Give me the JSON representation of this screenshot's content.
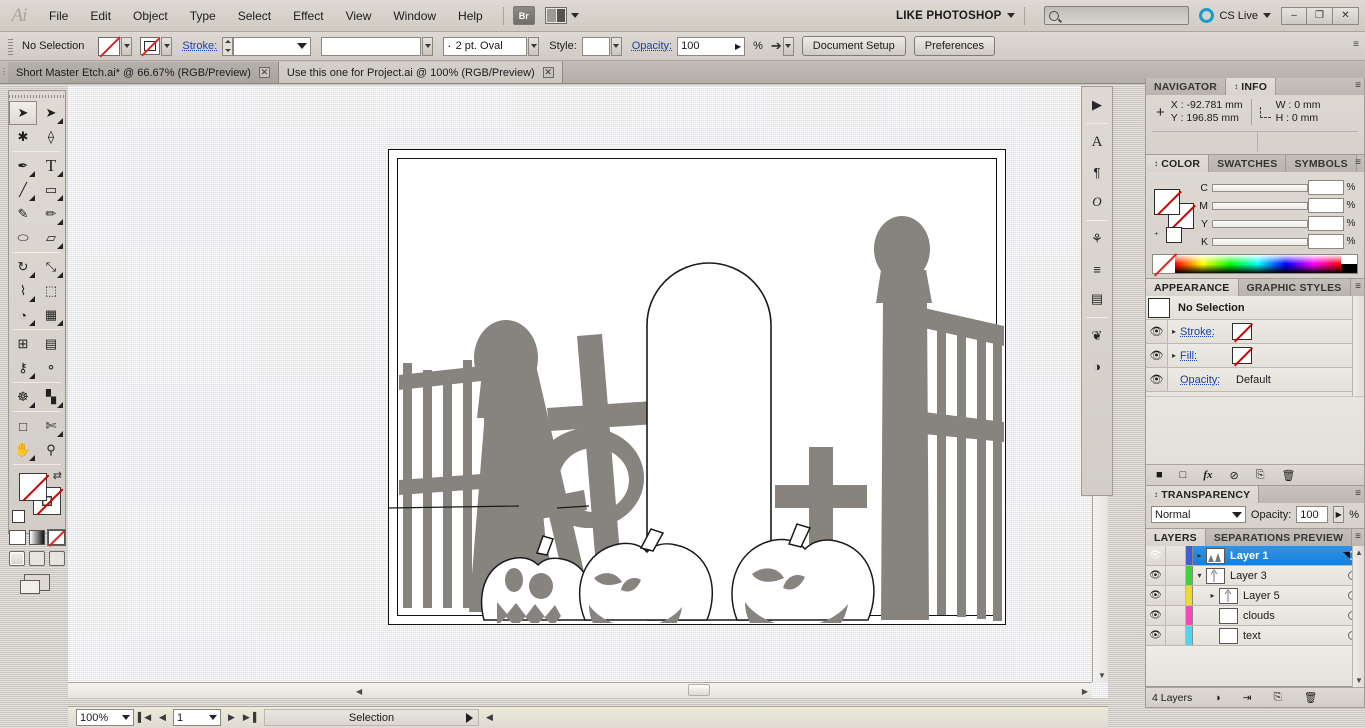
{
  "app": {
    "logo": "Ai",
    "workspace": "LIKE PHOTOSHOP",
    "cs_live": "CS Live",
    "search_placeholder": ""
  },
  "menus": [
    "File",
    "Edit",
    "Object",
    "Type",
    "Select",
    "Effect",
    "View",
    "Window",
    "Help"
  ],
  "menu_icons": {
    "bridge": "Br",
    "arrange": "arrange-documents-icon"
  },
  "window_buttons": {
    "minimize": "–",
    "restore": "❐",
    "close": "✕"
  },
  "control_bar": {
    "selection_status": "No Selection",
    "stroke_label": "Stroke:",
    "stroke_weight": "",
    "brush_definition": "",
    "stroke_profile": "2 pt. Oval",
    "style_label": "Style:",
    "opacity_label": "Opacity:",
    "opacity_value": "100",
    "percent": "%",
    "document_setup": "Document Setup",
    "preferences": "Preferences"
  },
  "tabs": [
    {
      "title": "Short Master Etch.ai* @ 66.67% (RGB/Preview)",
      "active": false,
      "close": "✕"
    },
    {
      "title": "Use this one for Project.ai @ 100% (RGB/Preview)",
      "active": true,
      "close": "✕"
    }
  ],
  "toolbar": {
    "tools": [
      {
        "name": "selection-tool",
        "glyph": "➤",
        "selected": true,
        "flyout": false
      },
      {
        "name": "direct-selection-tool",
        "glyph": "➤",
        "selected": false,
        "flyout": true
      },
      {
        "name": "magic-wand-tool",
        "glyph": "✳",
        "selected": false,
        "flyout": false
      },
      {
        "name": "lasso-tool",
        "glyph": "❀",
        "selected": false,
        "flyout": false
      },
      {
        "name": "pen-tool",
        "glyph": "✒",
        "selected": false,
        "flyout": true
      },
      {
        "name": "type-tool",
        "glyph": "T",
        "selected": false,
        "flyout": true
      },
      {
        "name": "line-segment-tool",
        "glyph": "╲",
        "selected": false,
        "flyout": true
      },
      {
        "name": "rectangle-tool",
        "glyph": "▭",
        "selected": false,
        "flyout": true
      },
      {
        "name": "paintbrush-tool",
        "glyph": "✎",
        "selected": false,
        "flyout": false
      },
      {
        "name": "pencil-tool",
        "glyph": "✐",
        "selected": false,
        "flyout": true
      },
      {
        "name": "blob-brush-tool",
        "glyph": "⬭",
        "selected": false,
        "flyout": false
      },
      {
        "name": "eraser-tool",
        "glyph": "▱",
        "selected": false,
        "flyout": true
      },
      {
        "name": "rotate-tool",
        "glyph": "↻",
        "selected": false,
        "flyout": true
      },
      {
        "name": "scale-tool",
        "glyph": "⤡",
        "selected": false,
        "flyout": true
      },
      {
        "name": "width-tool",
        "glyph": "⌇",
        "selected": false,
        "flyout": true
      },
      {
        "name": "free-transform-tool",
        "glyph": "⬚",
        "selected": false,
        "flyout": false
      },
      {
        "name": "shape-builder-tool",
        "glyph": "◔",
        "selected": false,
        "flyout": true
      },
      {
        "name": "perspective-grid-tool",
        "glyph": "▦",
        "selected": false,
        "flyout": true
      },
      {
        "name": "mesh-tool",
        "glyph": "⊞",
        "selected": false,
        "flyout": false
      },
      {
        "name": "gradient-tool",
        "glyph": "▤",
        "selected": false,
        "flyout": false
      },
      {
        "name": "eyedropper-tool",
        "glyph": "⚗",
        "selected": false,
        "flyout": true
      },
      {
        "name": "blend-tool",
        "glyph": "⚬",
        "selected": false,
        "flyout": false
      },
      {
        "name": "symbol-sprayer-tool",
        "glyph": "☸",
        "selected": false,
        "flyout": true
      },
      {
        "name": "column-graph-tool",
        "glyph": "█",
        "selected": false,
        "flyout": true
      },
      {
        "name": "artboard-tool",
        "glyph": "□",
        "selected": false,
        "flyout": false
      },
      {
        "name": "slice-tool",
        "glyph": "✄",
        "selected": false,
        "flyout": true
      },
      {
        "name": "hand-tool",
        "glyph": "✋",
        "selected": false,
        "flyout": true
      },
      {
        "name": "zoom-tool",
        "glyph": "⚲",
        "selected": false,
        "flyout": false
      }
    ],
    "fill_state": "none",
    "stroke_state": "none",
    "color_modes": [
      "color-mode",
      "gradient-mode",
      "none-mode"
    ],
    "draw_modes": [
      "draw-normal",
      "draw-behind",
      "draw-inside"
    ],
    "screen_mode": "change-screen-mode"
  },
  "icon_dock": [
    {
      "name": "flash-icon",
      "glyph": "▶"
    },
    {
      "name": "character-icon",
      "glyph": "A"
    },
    {
      "name": "paragraph-icon",
      "glyph": "¶"
    },
    {
      "name": "opentype-icon",
      "glyph": "O"
    },
    {
      "name": "brushes-icon",
      "glyph": "⚘"
    },
    {
      "name": "stroke-panel-icon",
      "glyph": "≡"
    },
    {
      "name": "gradient-panel-icon",
      "glyph": "▤"
    },
    {
      "name": "links-icon",
      "glyph": "❦"
    },
    {
      "name": "document-info-icon",
      "glyph": "◑"
    }
  ],
  "panels": {
    "navigator_info": {
      "tabs": [
        {
          "label": "NAVIGATOR",
          "active": false
        },
        {
          "label": "INFO",
          "active": true
        }
      ],
      "x_label": "X",
      "x_value": ": -92.781 mm",
      "y_label": "Y",
      "y_value": ": 196.85 mm",
      "w_label": "W",
      "w_value": ": 0 mm",
      "h_label": "H",
      "h_value": ": 0 mm"
    },
    "color": {
      "tabs": [
        {
          "label": "COLOR",
          "active": true
        },
        {
          "label": "SWATCHES",
          "active": false
        },
        {
          "label": "SYMBOLS",
          "active": false
        }
      ],
      "channels": [
        {
          "label": "C",
          "value": "",
          "unit": "%"
        },
        {
          "label": "M",
          "value": "",
          "unit": "%"
        },
        {
          "label": "Y",
          "value": "",
          "unit": "%"
        },
        {
          "label": "K",
          "value": "",
          "unit": "%"
        }
      ]
    },
    "appearance": {
      "tabs": [
        {
          "label": "APPEARANCE",
          "active": true
        },
        {
          "label": "GRAPHIC STYLES",
          "active": false
        }
      ],
      "header": "No Selection",
      "rows": [
        {
          "label": "Stroke:",
          "value": "",
          "has_swatch": true
        },
        {
          "label": "Fill:",
          "value": "",
          "has_swatch": true
        },
        {
          "label": "Opacity:",
          "value": "Default",
          "has_swatch": false
        }
      ],
      "footer_icons": [
        "add-new-stroke-icon",
        "add-new-fill-icon",
        "add-effect-icon",
        "clear-appearance-icon",
        "duplicate-item-icon",
        "delete-item-icon"
      ]
    },
    "transparency": {
      "tabs": [
        {
          "label": "TRANSPARENCY",
          "active": true
        }
      ],
      "blend_mode": "Normal",
      "opacity_label": "Opacity:",
      "opacity_value": "100",
      "percent": "%"
    },
    "layers": {
      "tabs": [
        {
          "label": "LAYERS",
          "active": true
        },
        {
          "label": "SEPARATIONS PREVIEW",
          "active": false
        }
      ],
      "rows": [
        {
          "name": "Layer 1",
          "color": "#3f5fd0",
          "selected": true,
          "indent": 0,
          "expandable": true,
          "expanded": false,
          "has_art": true
        },
        {
          "name": "Layer 3",
          "color": "#42d03f",
          "selected": false,
          "indent": 0,
          "expandable": true,
          "expanded": true,
          "has_art": true
        },
        {
          "name": "Layer 5",
          "color": "#ecdb2a",
          "selected": false,
          "indent": 1,
          "expandable": true,
          "expanded": false,
          "has_art": true
        },
        {
          "name": "clouds",
          "color": "#f049b9",
          "selected": false,
          "indent": 1,
          "expandable": false,
          "expanded": false,
          "has_art": false
        },
        {
          "name": "text",
          "color": "#4fd6ee",
          "selected": false,
          "indent": 1,
          "expandable": false,
          "expanded": false,
          "has_art": false
        }
      ],
      "footer_count": "4 Layers",
      "footer_icons": [
        "make-clipping-mask-icon",
        "create-new-sublayer-icon",
        "create-new-layer-icon",
        "delete-selection-icon"
      ]
    }
  },
  "status_bar": {
    "zoom": "100%",
    "first_page": "▌◀",
    "prev_page": "◀",
    "page": "1",
    "next_page": "▶",
    "last_page": "▶▐",
    "status_text": "Selection"
  },
  "artwork": {
    "description": "halloween-graveyard-silhouette",
    "fill": "#87847f",
    "line": "#1a1a1a"
  }
}
